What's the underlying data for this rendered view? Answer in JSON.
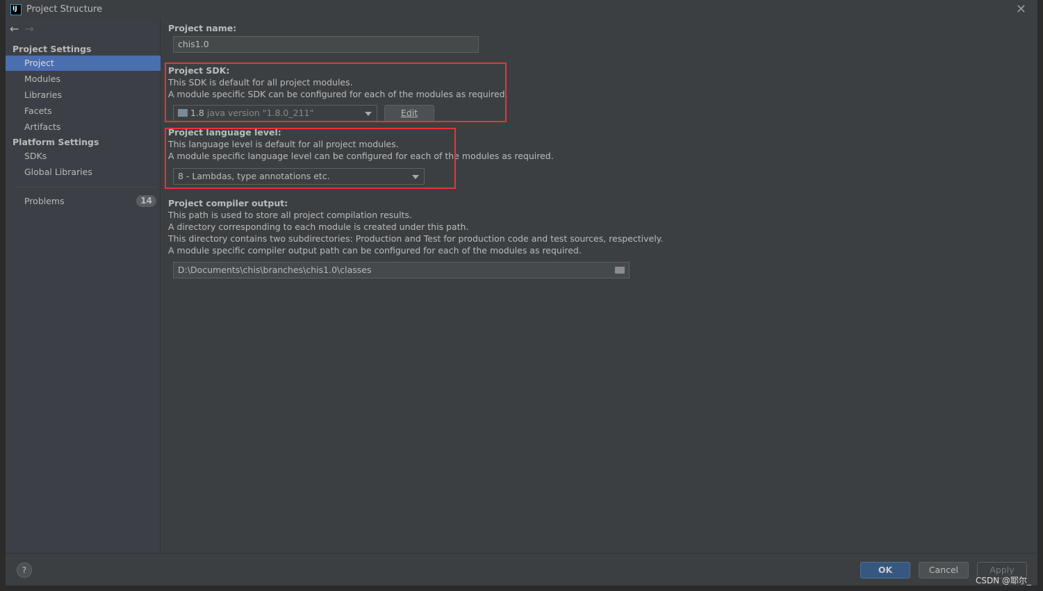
{
  "window": {
    "title": "Project Structure"
  },
  "sidebar": {
    "project_settings": "Project Settings",
    "items": [
      {
        "label": "Project"
      },
      {
        "label": "Modules"
      },
      {
        "label": "Libraries"
      },
      {
        "label": "Facets"
      },
      {
        "label": "Artifacts"
      }
    ],
    "platform_settings": "Platform Settings",
    "platform_items": [
      {
        "label": "SDKs"
      },
      {
        "label": "Global Libraries"
      }
    ],
    "problems": {
      "label": "Problems",
      "count": "14"
    }
  },
  "main": {
    "name": {
      "label": "Project name:",
      "value": "chis1.0"
    },
    "sdk": {
      "label": "Project SDK:",
      "line1": "This SDK is default for all project modules.",
      "line2": "A module specific SDK can be configured for each of the modules as required.",
      "version": "1.8",
      "detail": "java version \"1.8.0_211\"",
      "edit": "Edit"
    },
    "lang": {
      "label": "Project language level:",
      "line1": "This language level is default for all project modules.",
      "line2": "A module specific language level can be configured for each of the modules as required.",
      "value": "8 - Lambdas, type annotations etc."
    },
    "output": {
      "label": "Project compiler output:",
      "line1": "This path is used to store all project compilation results.",
      "line2": "A directory corresponding to each module is created under this path.",
      "line3": "This directory contains two subdirectories: Production and Test for production code and test sources, respectively.",
      "line4": "A module specific compiler output path can be configured for each of the modules as required.",
      "value": "D:\\Documents\\chis\\branches\\chis1.0\\classes"
    }
  },
  "footer": {
    "help": "?",
    "ok": "OK",
    "cancel": "Cancel",
    "apply": "Apply"
  },
  "watermark": "CSDN @耶尔_",
  "colors": {
    "selection": "#4b6eaf",
    "highlight_box": "#e8333a",
    "ok_button": "#365880"
  }
}
